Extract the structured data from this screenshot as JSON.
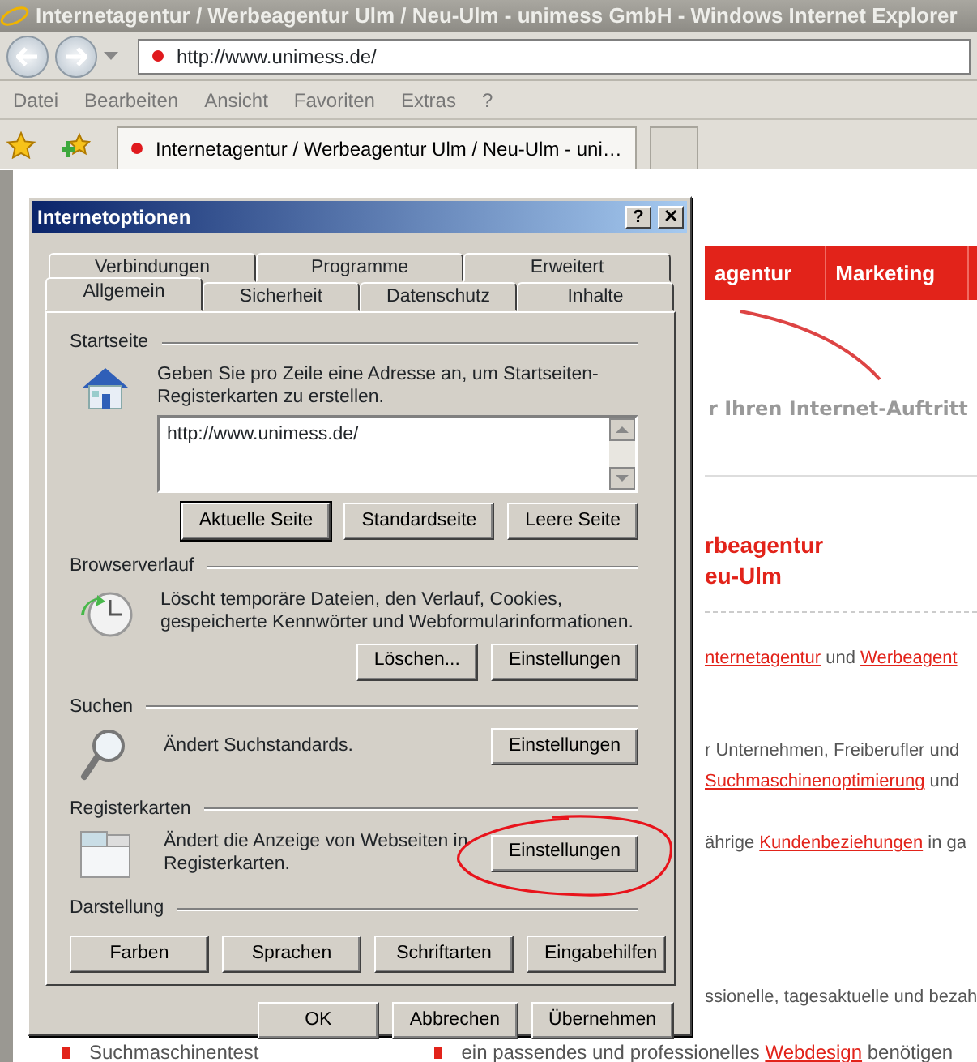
{
  "browser": {
    "title": "Internetagentur / Werbeagentur Ulm / Neu-Ulm - unimess GmbH - Windows Internet Explorer",
    "address": "http://www.unimess.de/",
    "menu": [
      "Datei",
      "Bearbeiten",
      "Ansicht",
      "Favoriten",
      "Extras",
      "?"
    ],
    "tabs": [
      {
        "label": "Internetagentur / Werbeagentur Ulm / Neu-Ulm - uni…",
        "selected": true
      }
    ]
  },
  "website": {
    "nav": [
      "agentur",
      "Marketing"
    ],
    "tagline": "r Ihren Internet-Auftritt",
    "heading": [
      "rbeagentur",
      "eu-Ulm"
    ],
    "lines": [
      [
        {
          "text": "nternetagentur",
          "link": true
        },
        {
          "text": " und ",
          "link": false
        },
        {
          "text": "Werbeagent",
          "link": true
        }
      ],
      [
        {
          "text": "r Unternehmen, Freiberufler und",
          "link": false
        }
      ],
      [
        {
          "text": "Suchmaschinenoptimierung",
          "link": true
        },
        {
          "text": " und",
          "link": false
        }
      ],
      [
        {
          "text": "ährige ",
          "link": false
        },
        {
          "text": "Kundenbeziehungen",
          "link": true
        },
        {
          "text": " in ga",
          "link": false
        }
      ],
      [
        {
          "text": "ssionelle, tagesaktuelle und bezah",
          "link": false
        }
      ]
    ],
    "footer_left": "Suchmaschinentest",
    "footer_right": [
      {
        "text": "ein passendes und professionelles ",
        "link": false
      },
      {
        "text": "Webdesign",
        "link": true
      },
      {
        "text": " benötigen",
        "link": false
      }
    ]
  },
  "dialog": {
    "title": "Internetoptionen",
    "help": "?",
    "close": "✕",
    "tab_rows": [
      [
        {
          "label": "Verbindungen",
          "selected": false
        },
        {
          "label": "Programme",
          "selected": false
        },
        {
          "label": "Erweitert",
          "selected": false
        }
      ],
      [
        {
          "label": "Allgemein",
          "selected": true
        },
        {
          "label": "Sicherheit",
          "selected": false
        },
        {
          "label": "Datenschutz",
          "selected": false
        },
        {
          "label": "Inhalte",
          "selected": false
        }
      ]
    ],
    "sections": [
      {
        "title": "Startseite",
        "text": "Geben Sie pro Zeile eine Adresse an, um Startseiten-Registerkarten zu erstellen.",
        "value": "http://www.unimess.de/",
        "buttons": [
          {
            "label": "Aktuelle Seite",
            "default": true,
            "circled": false
          },
          {
            "label": "Standardseite",
            "default": false,
            "circled": false
          },
          {
            "label": "Leere Seite",
            "default": false,
            "circled": false
          }
        ]
      },
      {
        "title": "Browserverlauf",
        "text": "Löscht temporäre Dateien, den Verlauf, Cookies, gespeicherte Kennwörter und Webformularinformationen.",
        "buttons": [
          {
            "label": "Löschen...",
            "default": false,
            "circled": false
          },
          {
            "label": "Einstellungen",
            "default": false,
            "circled": false
          }
        ]
      },
      {
        "title": "Suchen",
        "text": "Ändert Suchstandards.",
        "buttons": [
          {
            "label": "Einstellungen",
            "default": false,
            "circled": false
          }
        ]
      },
      {
        "title": "Registerkarten",
        "text": "Ändert die Anzeige von Webseiten in Registerkarten.",
        "buttons": [
          {
            "label": "Einstellungen",
            "default": false,
            "circled": true
          }
        ]
      },
      {
        "title": "Darstellung",
        "buttons": [
          {
            "label": "Farben",
            "default": false,
            "circled": false
          },
          {
            "label": "Sprachen",
            "default": false,
            "circled": false
          },
          {
            "label": "Schriftarten",
            "default": false,
            "circled": false
          },
          {
            "label": "Eingabehilfen",
            "default": false,
            "circled": false
          }
        ]
      }
    ],
    "footer_buttons": [
      {
        "label": "OK",
        "default": false,
        "circled": false
      },
      {
        "label": "Abbrechen",
        "default": false,
        "circled": false
      },
      {
        "label": "Übernehmen",
        "default": false,
        "circled": false
      }
    ]
  }
}
